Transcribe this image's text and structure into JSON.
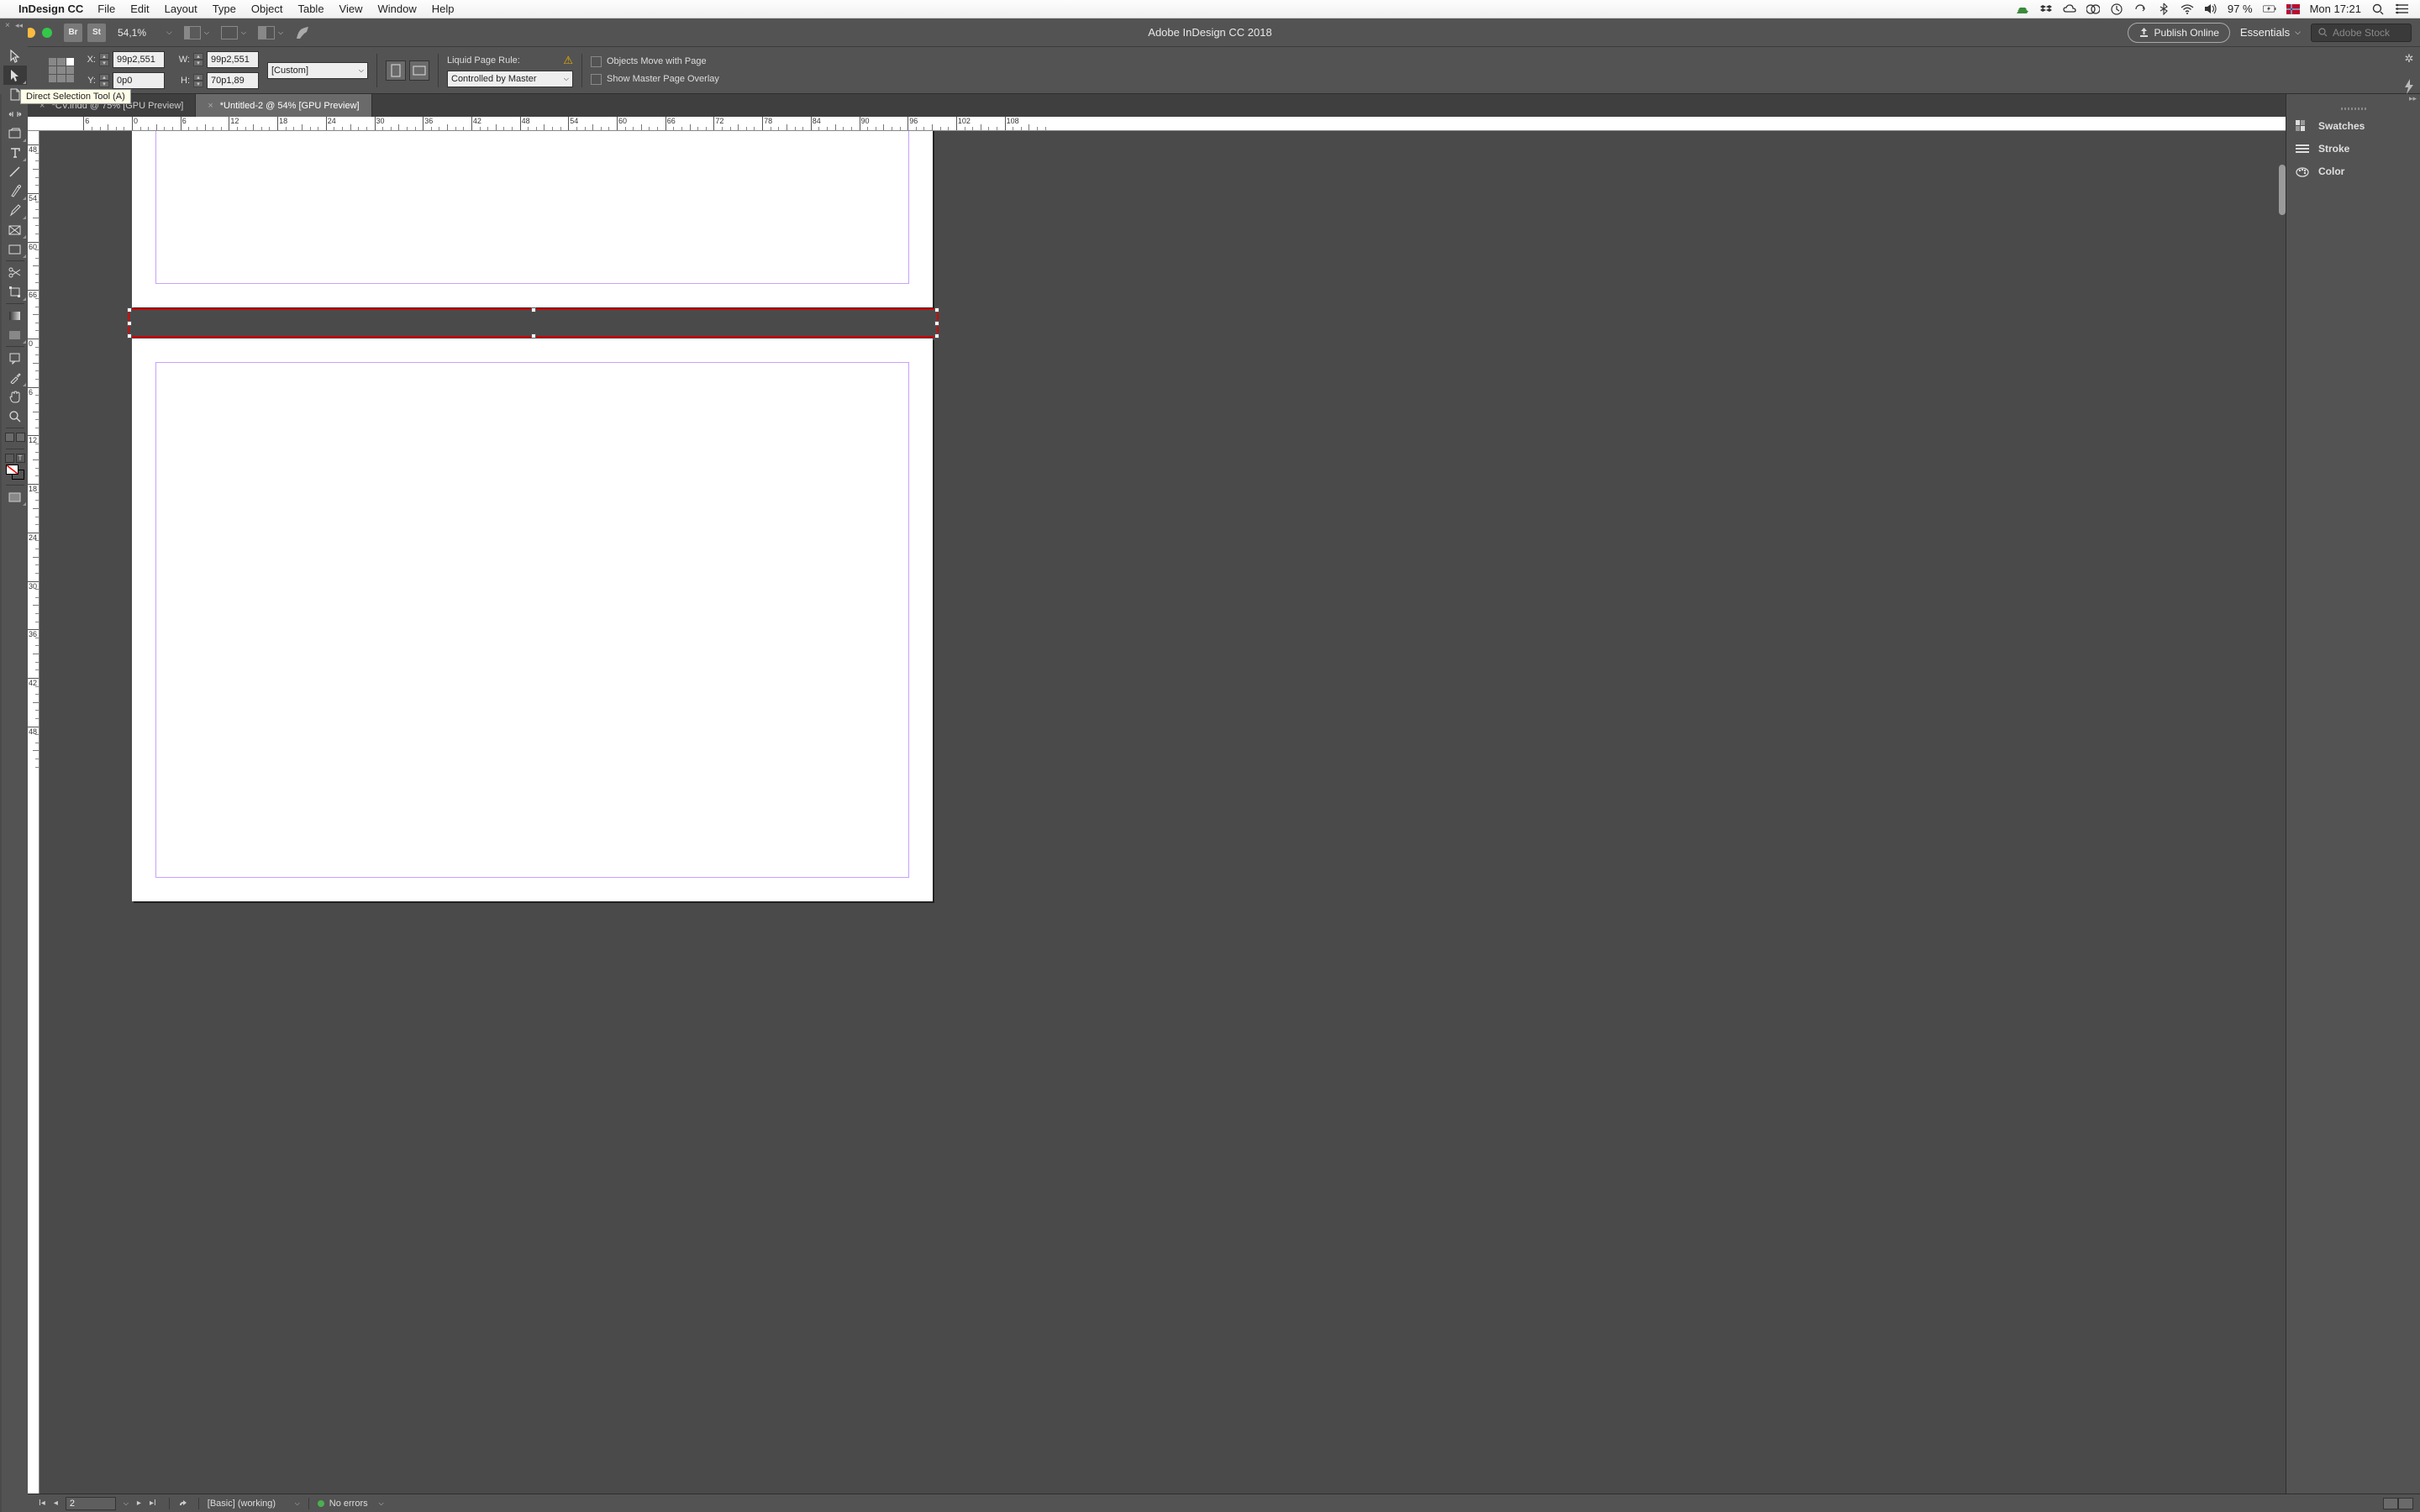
{
  "mac_menu": {
    "app_name": "InDesign CC",
    "items": [
      "File",
      "Edit",
      "Layout",
      "Type",
      "Object",
      "Table",
      "View",
      "Window",
      "Help"
    ],
    "battery_text": "97 %",
    "clock": "Mon 17:21"
  },
  "titlebar": {
    "app_title": "Adobe InDesign CC 2018",
    "zoom_pct": "54,1%",
    "br_label": "Br",
    "st_label": "St",
    "publish_label": "Publish Online",
    "workspace": "Essentials",
    "stock_placeholder": "Adobe Stock"
  },
  "control": {
    "x_label": "X:",
    "x_value": "99p2,551",
    "y_label": "Y:",
    "y_value": "0p0",
    "w_label": "W:",
    "w_value": "99p2,551",
    "h_label": "H:",
    "h_value": "70p1,89",
    "size_preset": "[Custom]",
    "liquid_label": "Liquid Page Rule:",
    "liquid_value": "Controlled by Master",
    "cb1": "Objects Move with Page",
    "cb2": "Show Master Page Overlay"
  },
  "doc_tabs": {
    "tab1": "*CV.indd @ 75% [GPU Preview]",
    "tab2": "*Untitled-2 @ 54% [GPU Preview]"
  },
  "tooltip": "Direct Selection Tool (A)",
  "ruler": {
    "h_numbers": [
      "6",
      "0",
      "6",
      "12",
      "18",
      "24",
      "30",
      "36",
      "42",
      "48",
      "54",
      "60",
      "66",
      "72",
      "78",
      "84",
      "90",
      "96",
      "102",
      "108"
    ],
    "v_numbers": [
      "48",
      "54",
      "60",
      "66",
      "0",
      "6",
      "12",
      "18",
      "24",
      "30",
      "36",
      "42"
    ]
  },
  "panels": {
    "swatches": "Swatches",
    "stroke": "Stroke",
    "color": "Color"
  },
  "status": {
    "page": "2",
    "style": "[Basic] (working)",
    "errors": "No errors"
  }
}
